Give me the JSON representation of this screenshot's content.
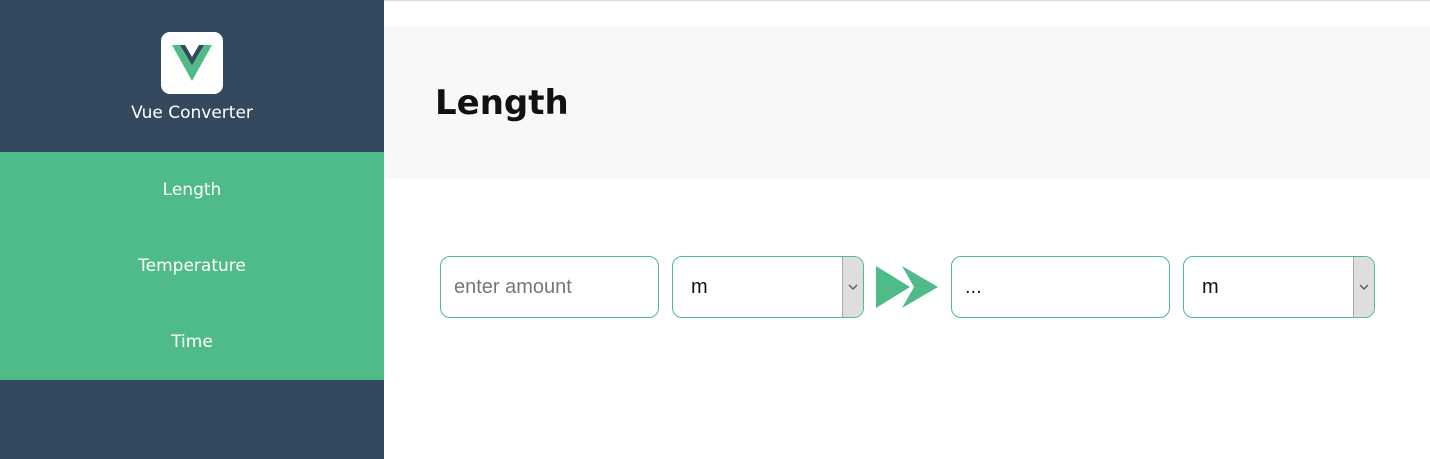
{
  "sidebar": {
    "brand": {
      "name": "Vue Converter",
      "logo_icon": "vue-logo-icon"
    },
    "items": [
      {
        "label": "Length"
      },
      {
        "label": "Temperature"
      },
      {
        "label": "Time"
      }
    ]
  },
  "main": {
    "title": "Length",
    "converter": {
      "amount": {
        "value": "",
        "placeholder": "enter amount"
      },
      "from_unit": {
        "selected": "m"
      },
      "result": {
        "value": "..."
      },
      "to_unit": {
        "selected": "m"
      },
      "arrow_icon": "double-chevron-right-icon"
    }
  },
  "colors": {
    "sidebar_bg": "#35495e",
    "accent": "#4fbb88",
    "header_bg": "#f8f8f8",
    "logo_dark": "#35495e"
  }
}
